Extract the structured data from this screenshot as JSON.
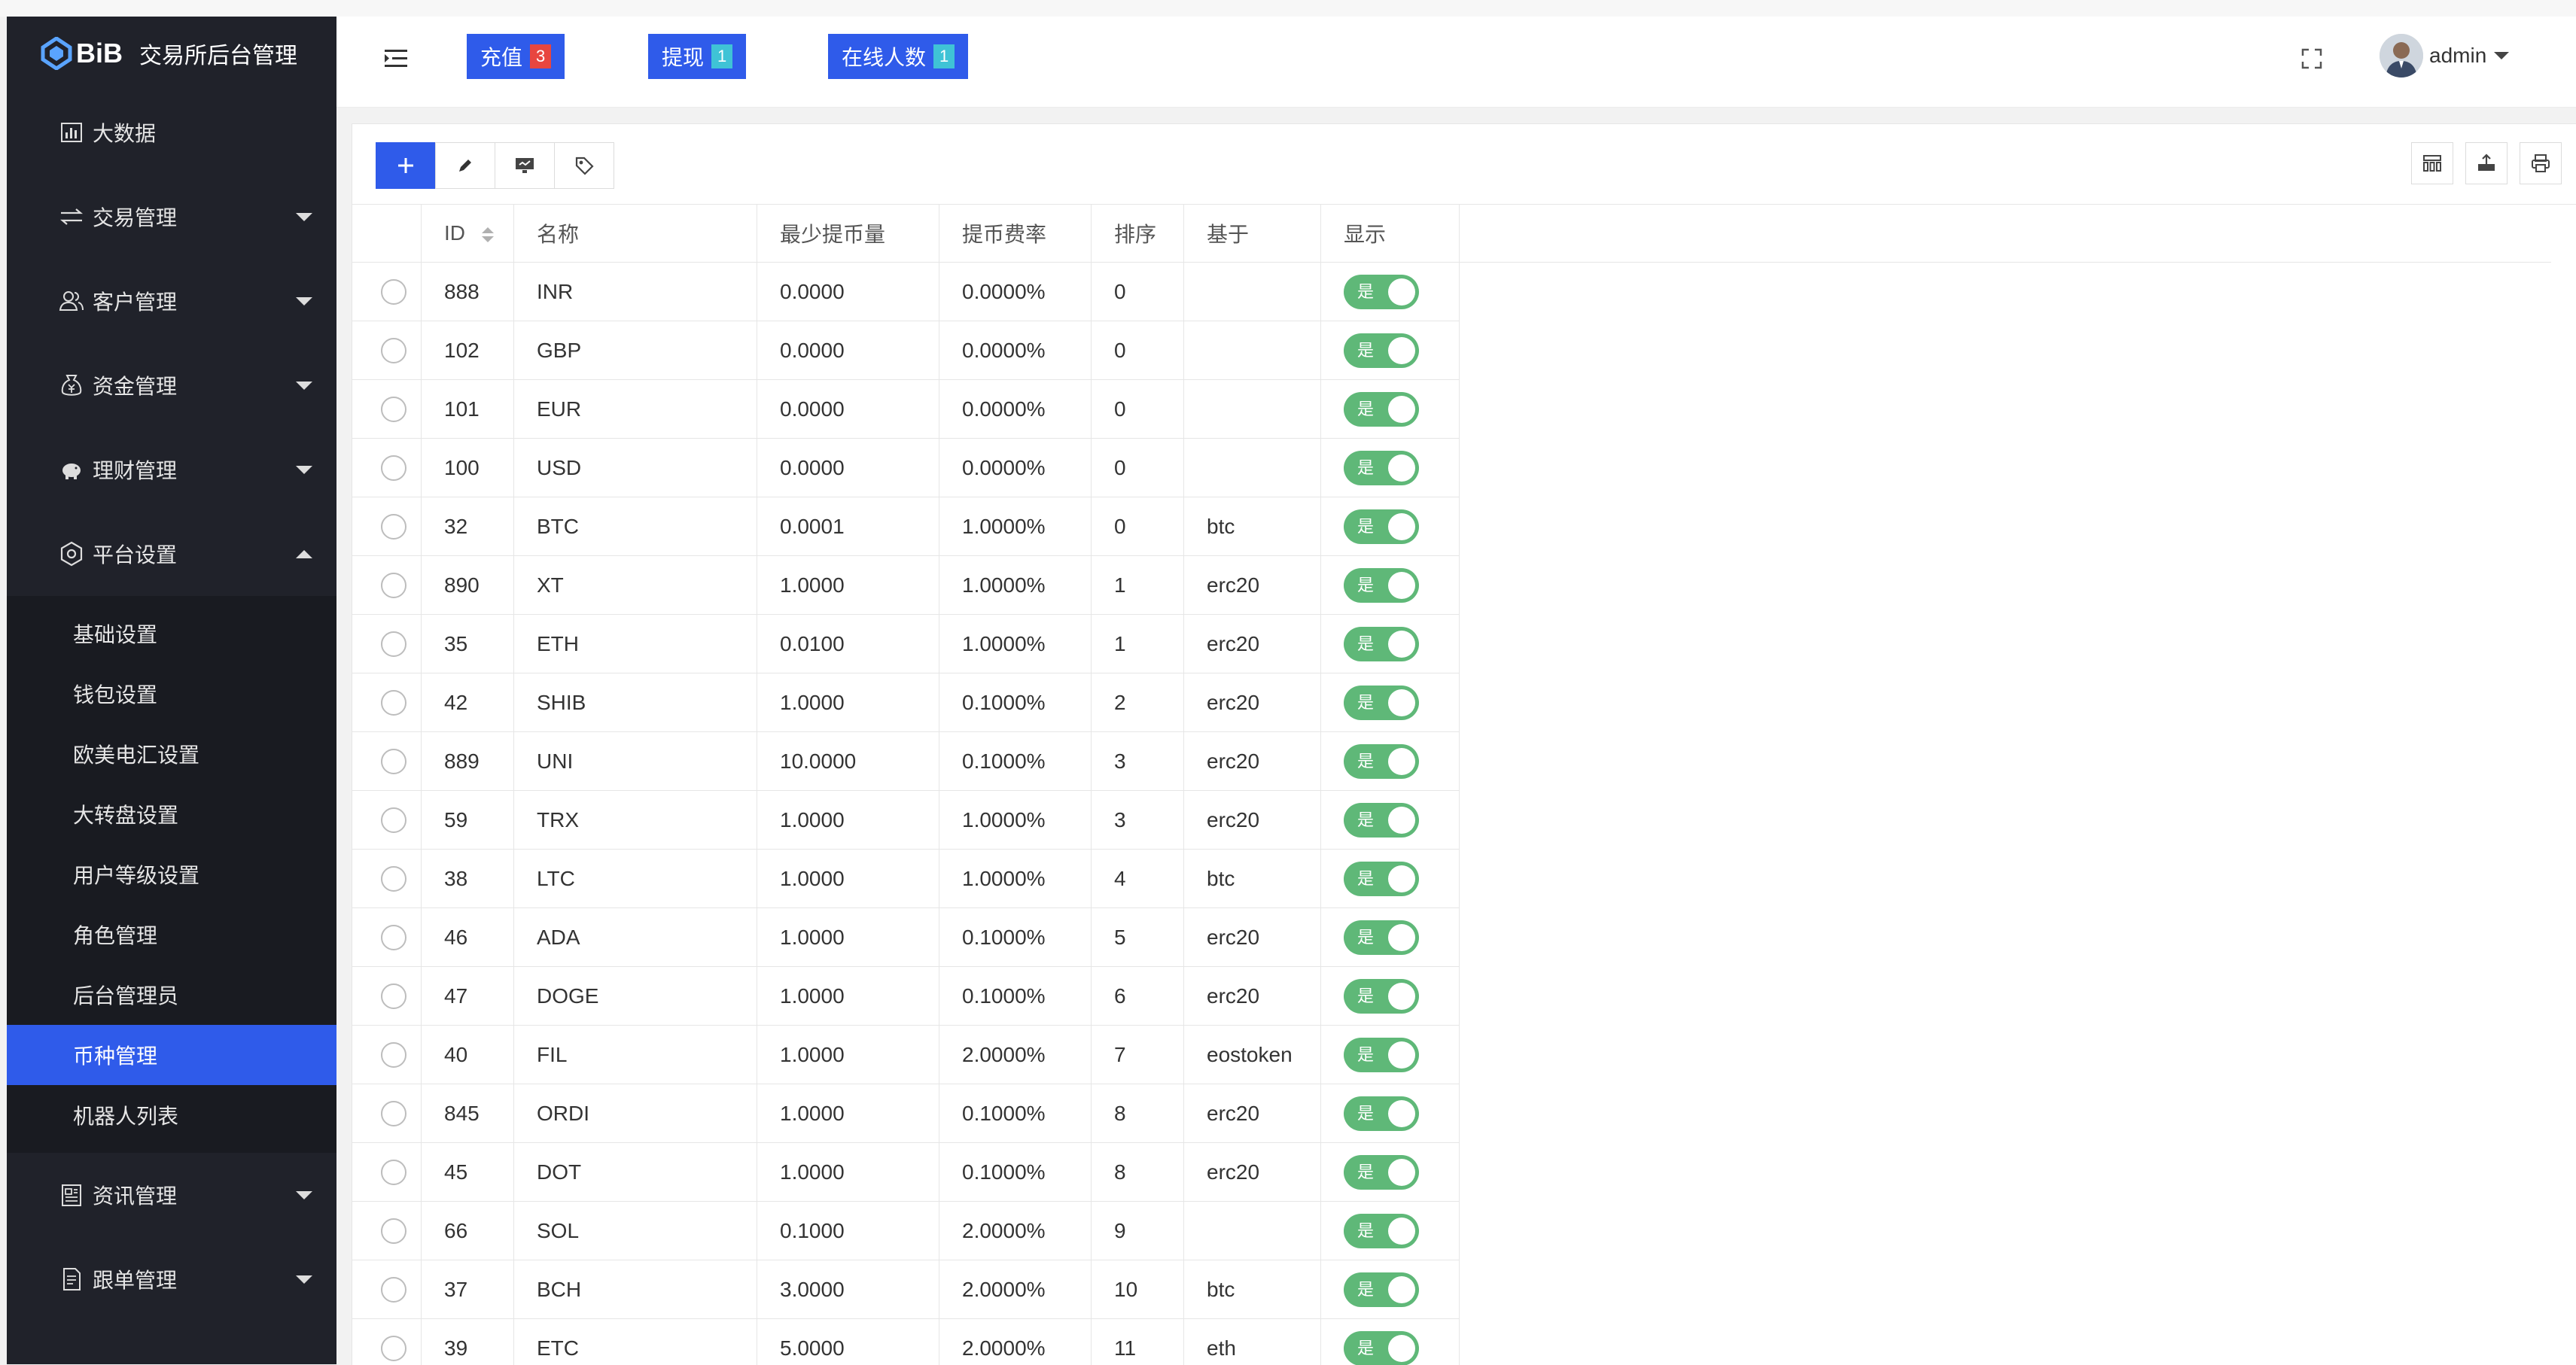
{
  "app": {
    "logo_text": "BiB",
    "title": "交易所后台管理"
  },
  "sidebar": {
    "items": [
      {
        "label": "大数据",
        "icon": "chart-icon"
      },
      {
        "label": "交易管理",
        "icon": "exchange-icon"
      },
      {
        "label": "客户管理",
        "icon": "users-icon"
      },
      {
        "label": "资金管理",
        "icon": "money-bag-icon"
      },
      {
        "label": "理财管理",
        "icon": "piggy-bank-icon"
      },
      {
        "label": "平台设置",
        "icon": "settings-icon",
        "expanded": true
      },
      {
        "label": "资讯管理",
        "icon": "news-icon"
      },
      {
        "label": "跟单管理",
        "icon": "document-icon"
      }
    ],
    "submenu": [
      {
        "label": "基础设置"
      },
      {
        "label": "钱包设置"
      },
      {
        "label": "欧美电汇设置"
      },
      {
        "label": "大转盘设置"
      },
      {
        "label": "用户等级设置"
      },
      {
        "label": "角色管理"
      },
      {
        "label": "后台管理员"
      },
      {
        "label": "币种管理",
        "active": true
      },
      {
        "label": "机器人列表"
      }
    ]
  },
  "header": {
    "buttons": [
      {
        "label": "充值",
        "badge": "3"
      },
      {
        "label": "提现",
        "badge": "1"
      },
      {
        "label": "在线人数",
        "badge": "1"
      }
    ],
    "user": {
      "name": "admin"
    }
  },
  "table": {
    "columns": [
      "ID",
      "名称",
      "最少提币量",
      "提币费率",
      "排序",
      "基于",
      "显示"
    ],
    "switch_on_label": "是",
    "rows": [
      [
        "888",
        "INR",
        "0.0000",
        "0.0000%",
        "0",
        ""
      ],
      [
        "102",
        "GBP",
        "0.0000",
        "0.0000%",
        "0",
        ""
      ],
      [
        "101",
        "EUR",
        "0.0000",
        "0.0000%",
        "0",
        ""
      ],
      [
        "100",
        "USD",
        "0.0000",
        "0.0000%",
        "0",
        ""
      ],
      [
        "32",
        "BTC",
        "0.0001",
        "1.0000%",
        "0",
        "btc"
      ],
      [
        "890",
        "XT",
        "1.0000",
        "1.0000%",
        "1",
        "erc20"
      ],
      [
        "35",
        "ETH",
        "0.0100",
        "1.0000%",
        "1",
        "erc20"
      ],
      [
        "42",
        "SHIB",
        "1.0000",
        "0.1000%",
        "2",
        "erc20"
      ],
      [
        "889",
        "UNI",
        "10.0000",
        "0.1000%",
        "3",
        "erc20"
      ],
      [
        "59",
        "TRX",
        "1.0000",
        "1.0000%",
        "3",
        "erc20"
      ],
      [
        "38",
        "LTC",
        "1.0000",
        "1.0000%",
        "4",
        "btc"
      ],
      [
        "46",
        "ADA",
        "1.0000",
        "0.1000%",
        "5",
        "erc20"
      ],
      [
        "47",
        "DOGE",
        "1.0000",
        "0.1000%",
        "6",
        "erc20"
      ],
      [
        "40",
        "FIL",
        "1.0000",
        "2.0000%",
        "7",
        "eostoken"
      ],
      [
        "845",
        "ORDI",
        "1.0000",
        "0.1000%",
        "8",
        "erc20"
      ],
      [
        "45",
        "DOT",
        "1.0000",
        "0.1000%",
        "8",
        "erc20"
      ],
      [
        "66",
        "SOL",
        "0.1000",
        "2.0000%",
        "9",
        ""
      ],
      [
        "37",
        "BCH",
        "3.0000",
        "2.0000%",
        "10",
        "btc"
      ],
      [
        "39",
        "ETC",
        "5.0000",
        "2.0000%",
        "11",
        "eth"
      ]
    ]
  },
  "colors": {
    "sidebar_bg": "#20222a",
    "accent": "#2f5bea",
    "switch_on": "#5fb878"
  }
}
